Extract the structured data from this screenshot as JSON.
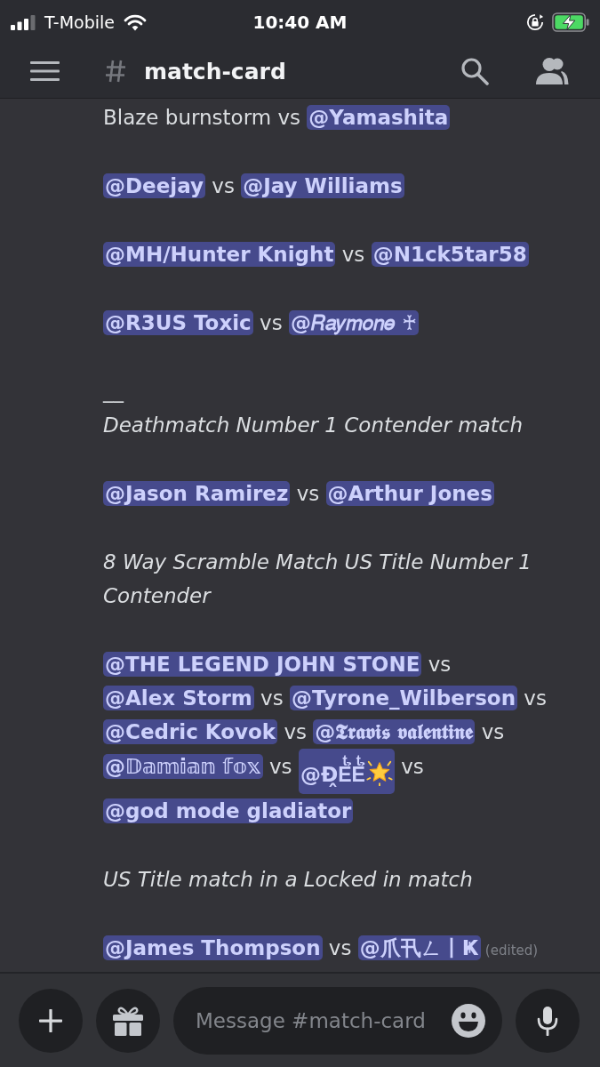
{
  "status_bar": {
    "carrier": "T-Mobile",
    "time": "10:40 AM"
  },
  "header": {
    "channel": "match-card"
  },
  "messages": [
    {
      "kind": "line",
      "parts": [
        {
          "kind": "text",
          "text": "Blaze burnstorm vs"
        },
        {
          "kind": "mention",
          "text": "@Yamashita"
        }
      ]
    },
    {
      "kind": "line",
      "parts": [
        {
          "kind": "mention",
          "text": "@Deejay"
        },
        {
          "kind": "text",
          "text": "vs"
        },
        {
          "kind": "mention",
          "text": "@Jay Williams"
        }
      ]
    },
    {
      "kind": "line",
      "parts": [
        {
          "kind": "mention",
          "text": "@MH/Hunter Knight"
        },
        {
          "kind": "text",
          "text": "vs"
        },
        {
          "kind": "mention",
          "text": "@N1ck5tar58"
        }
      ]
    },
    {
      "kind": "line",
      "parts": [
        {
          "kind": "mention",
          "text": "@R3US Toxic"
        },
        {
          "kind": "text",
          "text": "vs"
        },
        {
          "kind": "mention",
          "text": "@𝑅𝑎𝑦𝑚𝑜𝑛𝑒 ♰"
        }
      ]
    },
    {
      "kind": "separator",
      "text": "__"
    },
    {
      "kind": "heading",
      "text": "Deathmatch Number 1 Contender match"
    },
    {
      "kind": "line",
      "parts": [
        {
          "kind": "mention",
          "text": "@Jason Ramirez"
        },
        {
          "kind": "text",
          "text": "vs"
        },
        {
          "kind": "mention",
          "text": "@Arthur Jones"
        }
      ]
    },
    {
      "kind": "heading",
      "text": "8 Way Scramble Match US Title Number 1 Contender"
    },
    {
      "kind": "line",
      "parts": [
        {
          "kind": "mention",
          "text": "@THE LEGEND JOHN STONE"
        },
        {
          "kind": "text",
          "text": "vs"
        },
        {
          "kind": "mention",
          "text": "@Alex Storm"
        },
        {
          "kind": "text",
          "text": "vs"
        },
        {
          "kind": "mention",
          "text": "@Tyrone_Wilberson"
        },
        {
          "kind": "text",
          "text": "vs"
        },
        {
          "kind": "mention",
          "text": "@Cedric Kovok"
        },
        {
          "kind": "text",
          "text": "vs"
        },
        {
          "kind": "mention",
          "text": "@𝕿𝖗𝖆𝖛𝖎𝖘 𝖛𝖆𝖑𝖊𝖓𝖙𝖎𝖓𝖊"
        },
        {
          "kind": "text",
          "text": "vs"
        },
        {
          "kind": "mention",
          "text": "@𝔻𝕒𝕞𝕚𝕒𝕟 𝕗𝕠𝕩"
        },
        {
          "kind": "text",
          "text": "vs"
        },
        {
          "kind": "mention_emoji",
          "text": "@Đ̭Eͭ̉Eͭ̉"
        },
        {
          "kind": "text",
          "text": "vs"
        },
        {
          "kind": "mention",
          "text": "@god mode gladiator"
        }
      ]
    },
    {
      "kind": "heading",
      "text": "US Title match in a Locked in match"
    },
    {
      "kind": "line",
      "parts": [
        {
          "kind": "mention",
          "text": "@James Thompson"
        },
        {
          "kind": "text",
          "text": "vs"
        },
        {
          "kind": "mention",
          "text": "@爪卂ㄥ丨Ҝ"
        },
        {
          "kind": "edited",
          "text": "(edited)"
        }
      ]
    }
  ],
  "composer": {
    "placeholder": "Message #match-card"
  }
}
